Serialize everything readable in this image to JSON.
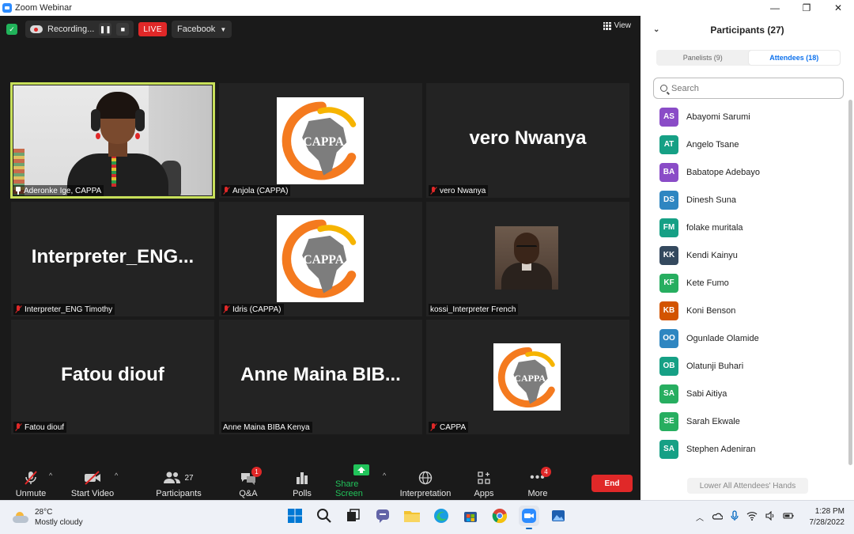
{
  "window": {
    "title": "Zoom Webinar",
    "controls": {
      "minimize": "—",
      "restore": "❐",
      "close": "✕"
    }
  },
  "topbar": {
    "recording_label": "Recording...",
    "pause_glyph": "❚❚",
    "stop_glyph": "■",
    "live_label": "LIVE",
    "stream_target": "Facebook",
    "view_label": "View"
  },
  "tiles": [
    {
      "name": "Aderonke Ige, CAPPA",
      "kind": "speaker",
      "muted": false,
      "active": true
    },
    {
      "name": "Anjola (CAPPA)",
      "kind": "logo",
      "muted": true
    },
    {
      "name": "vero Nwanya",
      "display_name": "vero Nwanya",
      "kind": "text",
      "muted": true
    },
    {
      "name": "Interpreter_ENG Timothy",
      "display_name": "Interpreter_ENG...",
      "kind": "text",
      "muted": true
    },
    {
      "name": "Idris (CAPPA)",
      "kind": "logo",
      "muted": true
    },
    {
      "name": "kossi_Interpreter French",
      "kind": "photo",
      "muted": false
    },
    {
      "name": "Fatou diouf",
      "display_name": "Fatou diouf",
      "kind": "text",
      "muted": true
    },
    {
      "name": "Anne Maina BIBA Kenya",
      "display_name": "Anne Maina BIB...",
      "kind": "text",
      "muted": false
    },
    {
      "name": "CAPPA",
      "kind": "logo",
      "muted": true
    }
  ],
  "logo": {
    "text": "CAPPA",
    "orange": "#f47a1f",
    "yellow": "#f6b400",
    "grey": "#7d7d7d"
  },
  "toolbar": {
    "unmute": "Unmute",
    "start_video": "Start Video",
    "participants": "Participants",
    "participants_count": "27",
    "qa": "Q&A",
    "qa_badge": "1",
    "polls": "Polls",
    "share_screen": "Share Screen",
    "interpretation": "Interpretation",
    "apps": "Apps",
    "more": "More",
    "more_badge": "4",
    "end": "End"
  },
  "panel": {
    "title": "Participants (27)",
    "tab_panelists": "Panelists (9)",
    "tab_attendees": "Attendees (18)",
    "search_placeholder": "Search",
    "lower_hands": "Lower All Attendees' Hands",
    "attendees": [
      {
        "initials": "AS",
        "name": "Abayomi Sarumi",
        "color": "#8a4cc7"
      },
      {
        "initials": "AT",
        "name": "Angelo Tsane",
        "color": "#16a085"
      },
      {
        "initials": "BA",
        "name": "Babatope Adebayo",
        "color": "#8a4cc7"
      },
      {
        "initials": "DS",
        "name": "Dinesh Suna",
        "color": "#2e86c1"
      },
      {
        "initials": "FM",
        "name": "folake muritala",
        "color": "#16a085"
      },
      {
        "initials": "KK",
        "name": "Kendi Kainyu",
        "color": "#34495e"
      },
      {
        "initials": "KF",
        "name": "Kete Fumo",
        "color": "#27ae60"
      },
      {
        "initials": "KB",
        "name": "Koni Benson",
        "color": "#d35400"
      },
      {
        "initials": "OO",
        "name": "Ogunlade Olamide",
        "color": "#2e86c1"
      },
      {
        "initials": "OB",
        "name": "Olatunji Buhari",
        "color": "#16a085"
      },
      {
        "initials": "SA",
        "name": "Sabi Aitiya",
        "color": "#27ae60"
      },
      {
        "initials": "SE",
        "name": "Sarah Ekwale",
        "color": "#27ae60"
      },
      {
        "initials": "SA",
        "name": "Stephen Adeniran",
        "color": "#16a085"
      }
    ]
  },
  "taskbar": {
    "temperature": "28°C",
    "weather": "Mostly cloudy",
    "time": "1:28 PM",
    "date": "7/28/2022"
  }
}
